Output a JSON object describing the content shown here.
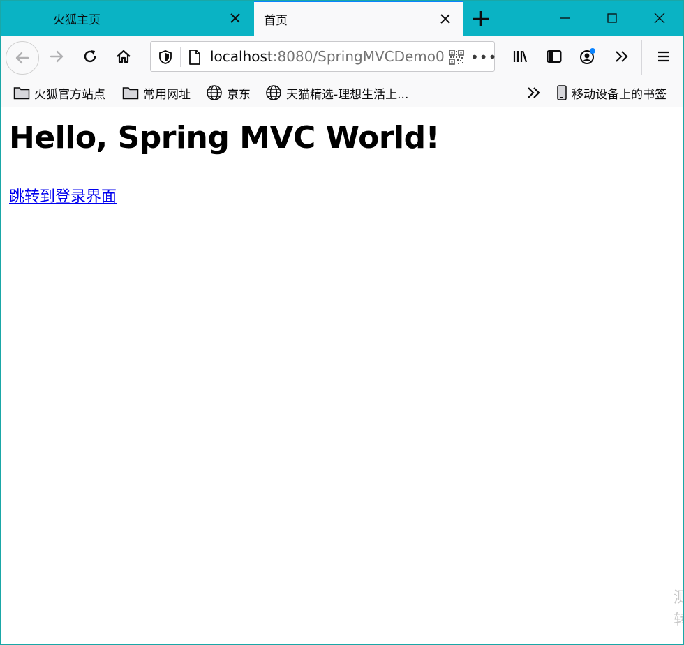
{
  "tabs": [
    {
      "label": "火狐主页"
    },
    {
      "label": "首页"
    }
  ],
  "urlbar": {
    "host": "localhost",
    "path": ":8080/SpringMVCDemo0"
  },
  "bookmarks": [
    {
      "label": "火狐官方站点",
      "icon": "folder-icon"
    },
    {
      "label": "常用网址",
      "icon": "folder-icon"
    },
    {
      "label": "京东",
      "icon": "globe-icon"
    },
    {
      "label": "天猫精选-理想生活上...",
      "icon": "globe-icon"
    }
  ],
  "bookmarks_mobile": {
    "label": "移动设备上的书签"
  },
  "page": {
    "heading": "Hello, Spring MVC World!",
    "link": "跳转到登录界面"
  },
  "watermark": {
    "line1": "测",
    "line2": "转"
  },
  "colors": {
    "tabstrip": "#0ab3c4",
    "active_tab_accent": "#0a84ff",
    "link": "#0000ee"
  }
}
